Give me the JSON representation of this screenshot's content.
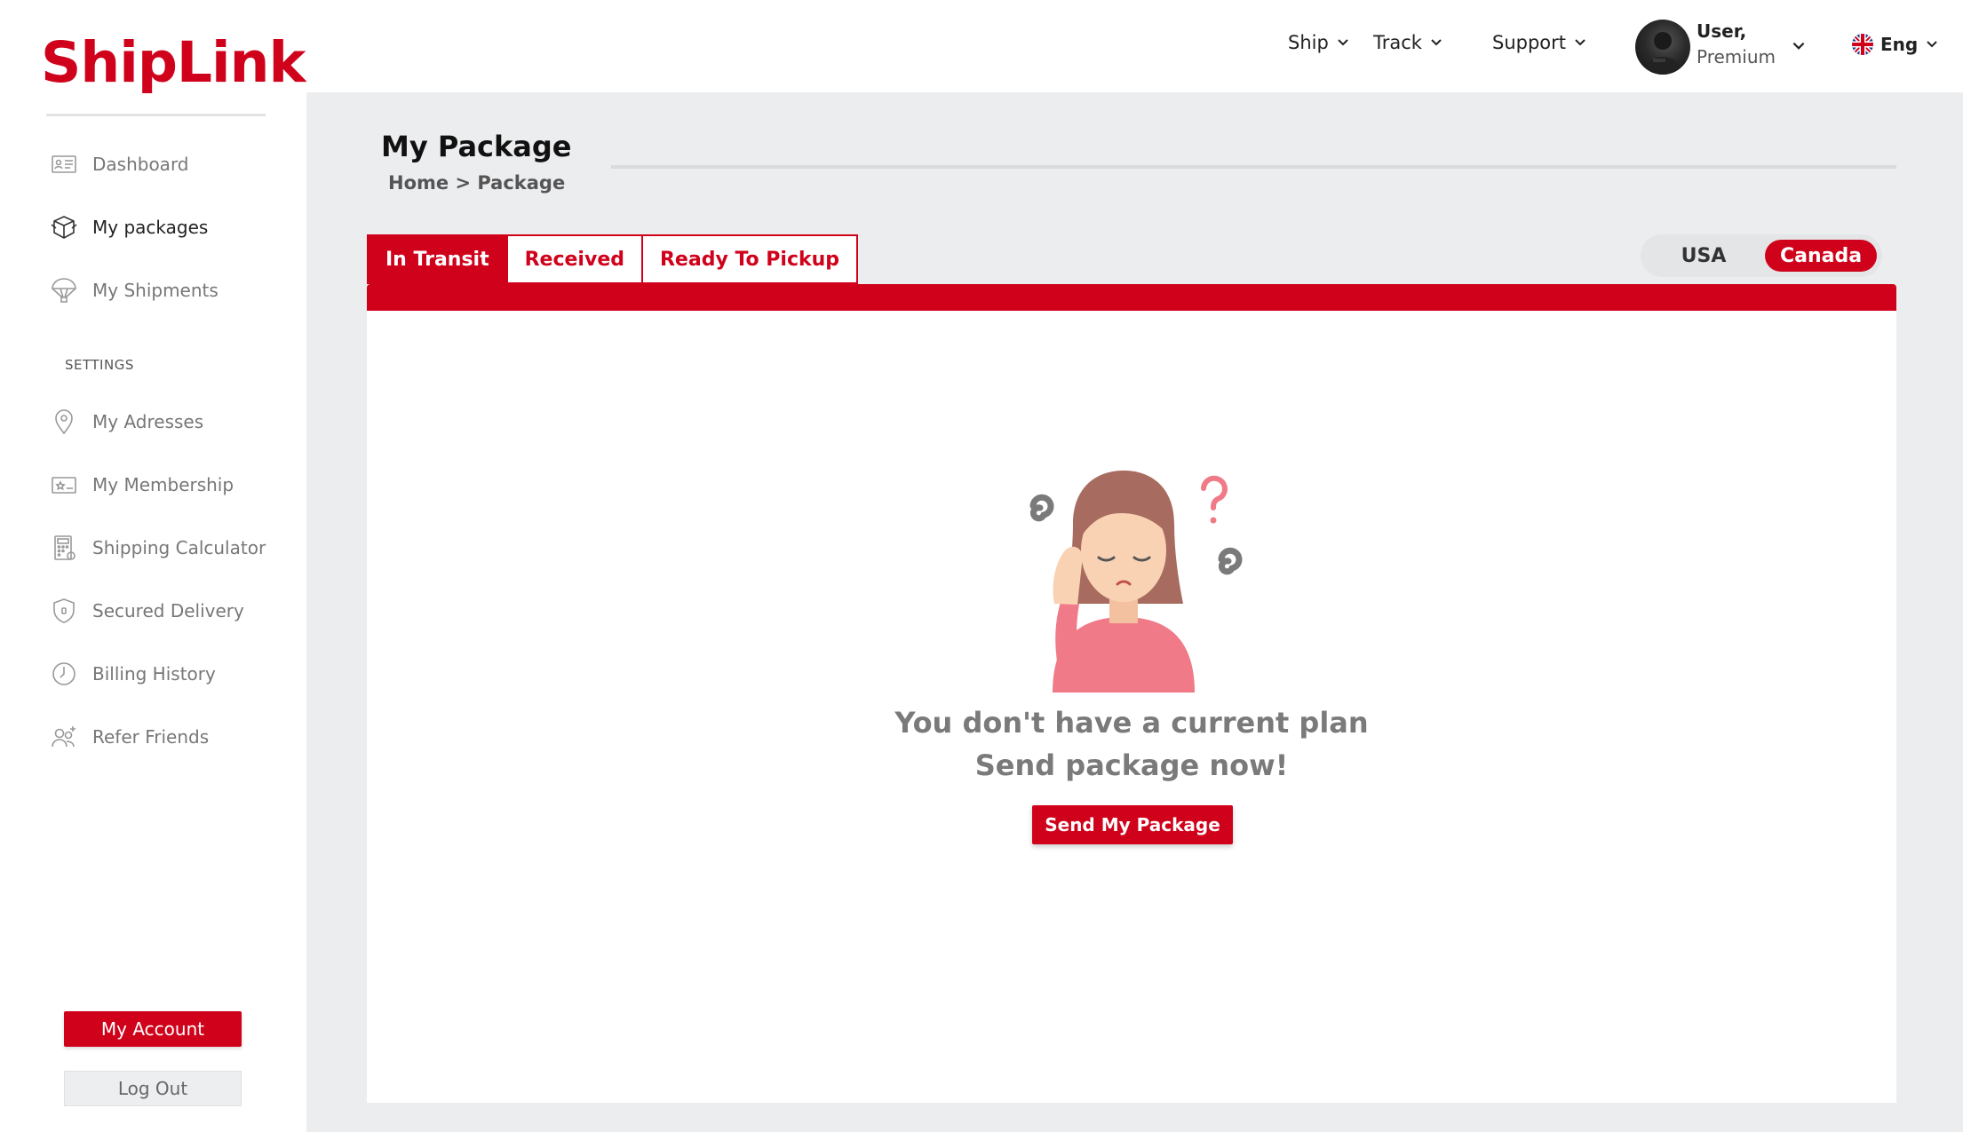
{
  "brand": {
    "name": "ShipLink",
    "color": "#d0021b"
  },
  "sidebar": {
    "items": [
      {
        "label": "Dashboard",
        "icon": "dashboard-icon"
      },
      {
        "label": "My packages",
        "icon": "package-icon"
      },
      {
        "label": "My Shipments",
        "icon": "parachute-icon"
      }
    ],
    "settings_label": "SETTINGS",
    "settings_items": [
      {
        "label": "My Adresses",
        "icon": "location-pin-icon"
      },
      {
        "label": "My Membership",
        "icon": "membership-card-icon"
      },
      {
        "label": "Shipping Calculator",
        "icon": "calculator-icon"
      },
      {
        "label": "Secured Delivery",
        "icon": "shield-icon"
      },
      {
        "label": "Billing History",
        "icon": "clock-icon"
      },
      {
        "label": "Refer Friends",
        "icon": "refer-friends-icon"
      }
    ],
    "account_button": "My Account",
    "logout_button": "Log Out"
  },
  "topbar": {
    "nav": [
      "Ship",
      "Track",
      "Support"
    ],
    "user": {
      "name": "User,",
      "plan": "Premium"
    },
    "language": "Eng"
  },
  "main": {
    "title": "My Package",
    "breadcrumb": "Home > Package",
    "tabs": [
      "In Transit",
      "Received",
      "Ready To Pickup"
    ],
    "active_tab": "In Transit",
    "regions": [
      "USA",
      "Canada"
    ],
    "active_region": "Canada",
    "empty_state": {
      "line1": "You don't have a current plan",
      "line2": "Send package now!",
      "button": "Send My Package"
    }
  }
}
